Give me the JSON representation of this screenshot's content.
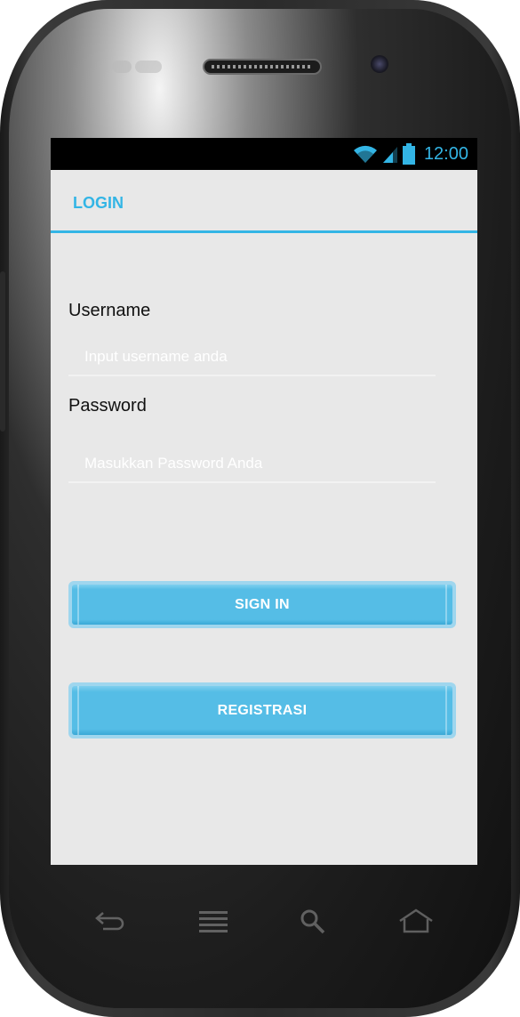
{
  "status_bar": {
    "time": "12:00"
  },
  "action_bar": {
    "title": "LOGIN"
  },
  "form": {
    "username_label": "Username",
    "username_placeholder": "Input username anda",
    "username_value": "",
    "password_label": "Password",
    "password_placeholder": "Masukkan Password Anda",
    "password_value": ""
  },
  "buttons": {
    "signin_label": "SIGN IN",
    "register_label": "REGISTRASI"
  },
  "colors": {
    "accent": "#33b5e5",
    "button": "#55bde6",
    "screen_bg": "#e8e8e8"
  },
  "icons": {
    "status": [
      "wifi-icon",
      "signal-icon",
      "battery-icon"
    ],
    "nav": [
      "back-icon",
      "menu-icon",
      "search-icon",
      "home-icon"
    ]
  }
}
